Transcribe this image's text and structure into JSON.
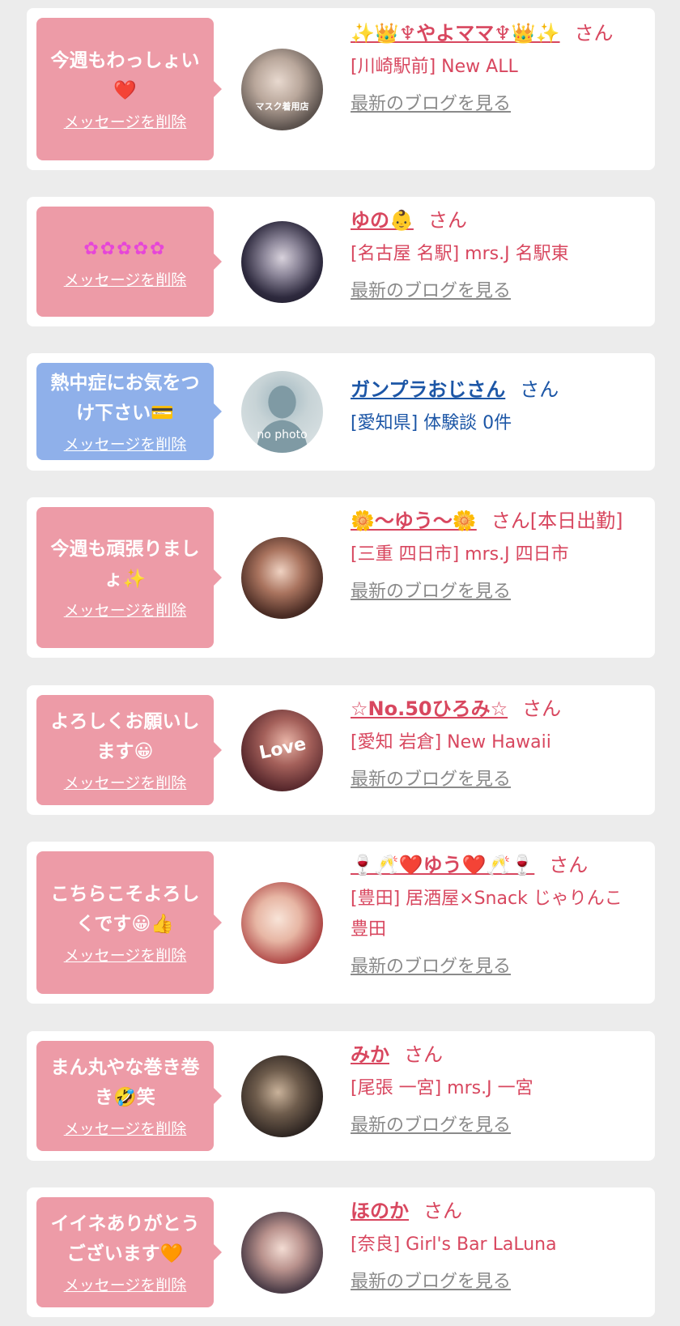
{
  "delete_label": "メッセージを削除",
  "blog_label": "最新のブログを見る",
  "san_label": "さん",
  "cards": [
    {
      "message": "今週もわっしょい❤️",
      "name": "✨👑♆やよママ♆👑✨",
      "suffix": "さん",
      "shop": "[川崎駅前] New ALL",
      "blog": "最新のブログを見る",
      "avatar_overlay": "マスク着用店"
    },
    {
      "message": "✿✿✿✿✿",
      "name": "ゆの👶",
      "suffix": "さん",
      "shop": "[名古屋 名駅] mrs.J 名駅東",
      "blog": "最新のブログを見る"
    },
    {
      "message": "熱中症にお気をつけ下さい💳",
      "name": "ガンプラおじさん",
      "suffix": "さん",
      "shop": "[愛知県] 体験談 0件",
      "avatar_overlay": "no photo"
    },
    {
      "message": "今週も頑張りましょ✨",
      "name": "🌼〜ゆう〜🌼",
      "suffix": "さん[本日出勤]",
      "shop": "[三重 四日市] mrs.J 四日市",
      "blog": "最新のブログを見る"
    },
    {
      "message": "よろしくお願いします😀",
      "name": "☆No.50ひろみ☆",
      "suffix": "さん",
      "shop": "[愛知 岩倉] New Hawaii",
      "blog": "最新のブログを見る",
      "avatar_overlay": "Love"
    },
    {
      "message": "こちらこそよろしくです😀👍",
      "name": "🍷🥂❤️ゆう❤️🥂🍷",
      "suffix": "さん",
      "shop": "[豊田] 居酒屋×Snack じゃりんこ豊田",
      "blog": "最新のブログを見る"
    },
    {
      "message": "まん丸やな巻き巻き🤣笑",
      "name": "みか",
      "suffix": "さん",
      "shop": "[尾張 一宮] mrs.J 一宮",
      "blog": "最新のブログを見る"
    },
    {
      "message": "イイネありがとうございます🧡",
      "name": "ほのか",
      "suffix": "さん",
      "shop": "[奈良] Girl's Bar LaLuna",
      "blog": "最新のブログを見る"
    }
  ],
  "colors": {
    "pink_bubble": "#ed9ba7",
    "blue_bubble": "#8fb0ea",
    "name_pink": "#d8475f",
    "name_blue": "#1c56a6",
    "blog_gray": "#8a8a8a"
  }
}
